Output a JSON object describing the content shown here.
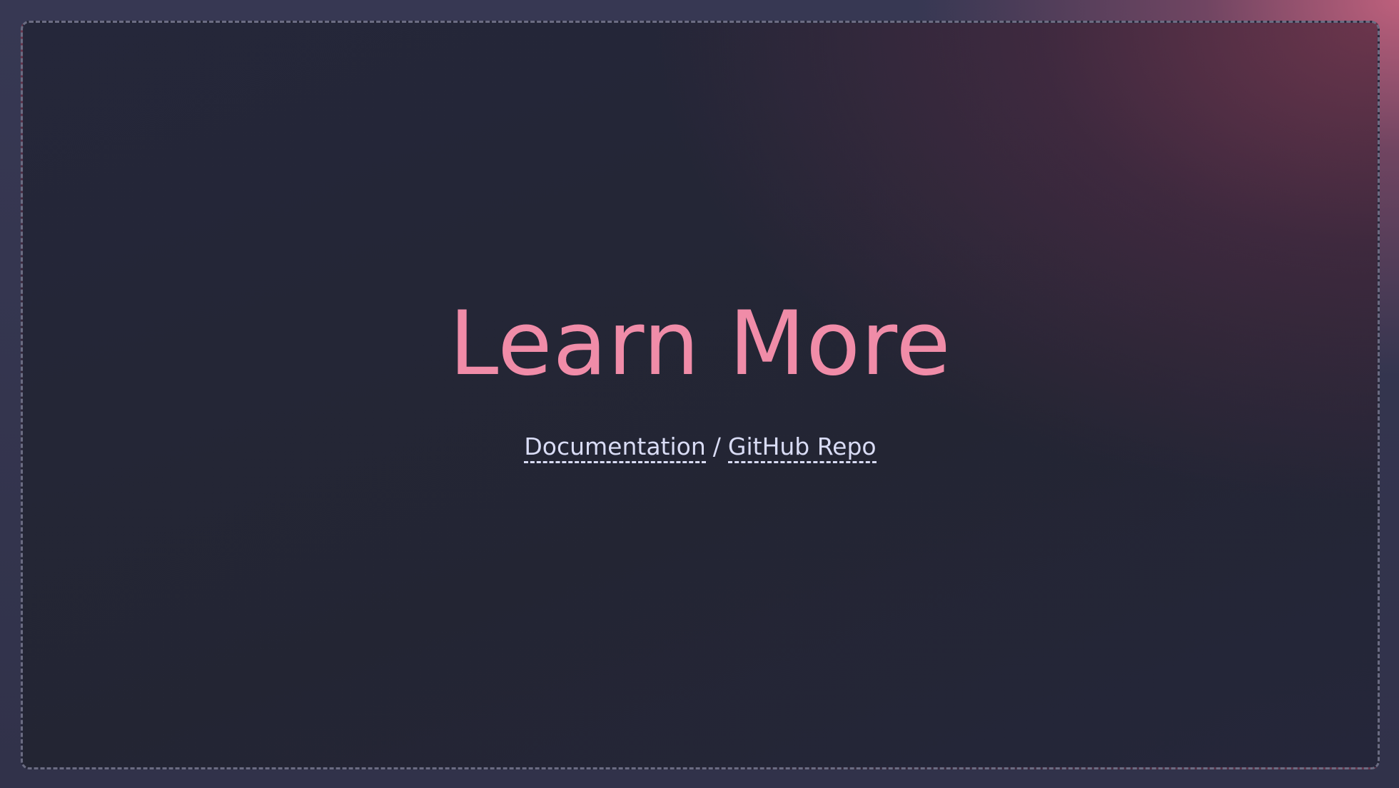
{
  "slide": {
    "title": "Learn More",
    "links": [
      {
        "label": "Documentation"
      },
      {
        "label": "GitHub Repo"
      }
    ],
    "separator": "/"
  },
  "colors": {
    "title": "#f08ca8",
    "link": "#d9dcf5",
    "frame_background": "#232533",
    "accent_glow": "#c4627e"
  }
}
